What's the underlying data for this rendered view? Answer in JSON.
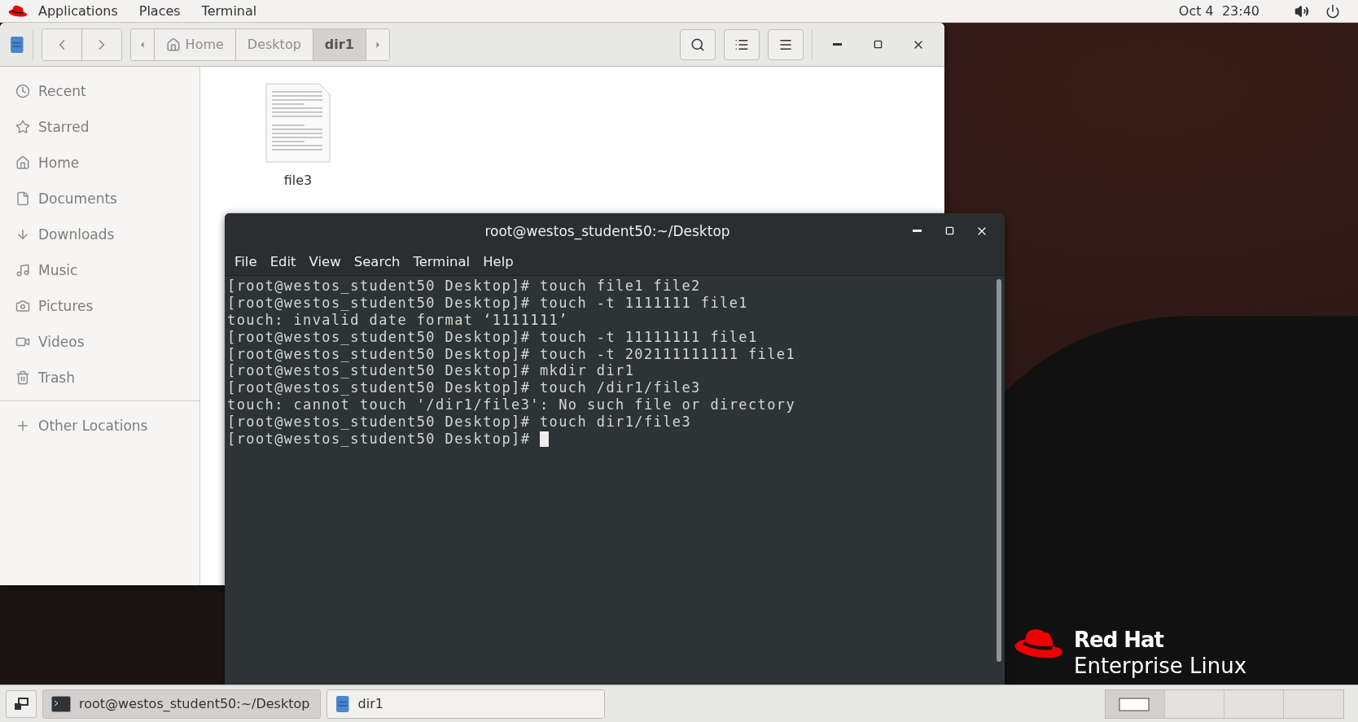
{
  "top_bar": {
    "menus": [
      "Applications",
      "Places",
      "Terminal"
    ],
    "clock": "Oct 4  23:40"
  },
  "files_window": {
    "path": [
      {
        "label": "Home",
        "selected": false
      },
      {
        "label": "Desktop",
        "selected": false
      },
      {
        "label": "dir1",
        "selected": true
      }
    ],
    "sidebar": [
      "Recent",
      "Starred",
      "Home",
      "Documents",
      "Downloads",
      "Music",
      "Pictures",
      "Videos",
      "Trash"
    ],
    "other_locations": "Other Locations",
    "files": [
      {
        "name": "file3"
      }
    ]
  },
  "terminal_window": {
    "title": "root@westos_student50:~/Desktop",
    "menu": [
      "File",
      "Edit",
      "View",
      "Search",
      "Terminal",
      "Help"
    ],
    "lines": [
      "[root@westos_student50 Desktop]# touch file1 file2",
      "[root@westos_student50 Desktop]# touch -t 1111111 file1",
      "touch: invalid date format ‘1111111’",
      "[root@westos_student50 Desktop]# touch -t 11111111 file1",
      "[root@westos_student50 Desktop]# touch -t 202111111111 file1",
      "[root@westos_student50 Desktop]# mkdir dir1",
      "[root@westos_student50 Desktop]# touch /dir1/file3",
      "touch: cannot touch '/dir1/file3': No such file or directory",
      "[root@westos_student50 Desktop]# touch dir1/file3",
      "[root@westos_student50 Desktop]# "
    ]
  },
  "logo": {
    "line_1": "Red Hat",
    "line_2": "Enterprise Linux"
  },
  "taskbar": {
    "tasks": [
      {
        "label": "root@westos_student50:~/Desktop",
        "kind": "terminal",
        "selected": true
      },
      {
        "label": "dir1",
        "kind": "files",
        "selected": false
      }
    ],
    "workspaces": [
      {
        "selected": true
      },
      {
        "selected": false
      },
      {
        "selected": false
      },
      {
        "selected": false
      }
    ]
  }
}
